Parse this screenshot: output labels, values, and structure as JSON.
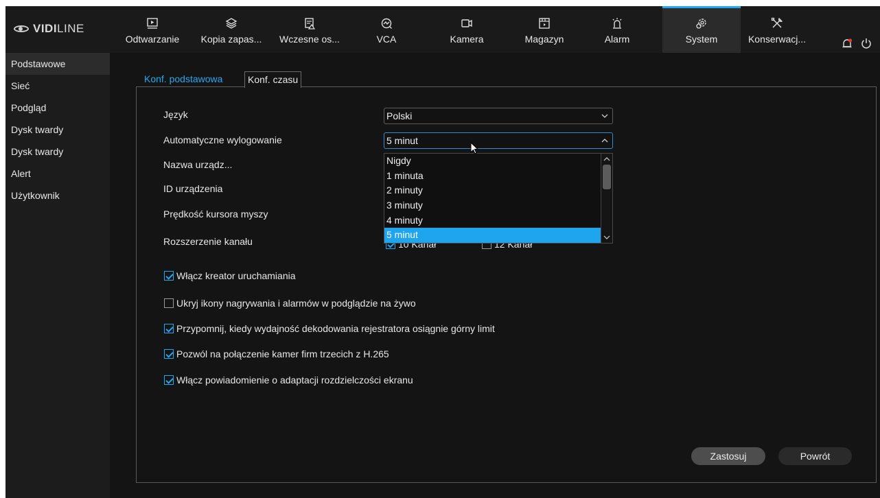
{
  "brand": {
    "name_bold": "VIDI",
    "name_thin": "LINE"
  },
  "nav": [
    {
      "label": "Odtwarzanie",
      "icon": "playback-icon"
    },
    {
      "label": "Kopia zapas...",
      "icon": "backup-layers-icon"
    },
    {
      "label": "Wczesne os...",
      "icon": "warning-document-icon"
    },
    {
      "label": "VCA",
      "icon": "vca-analytics-icon"
    },
    {
      "label": "Kamera",
      "icon": "camera-icon"
    },
    {
      "label": "Magazyn",
      "icon": "storage-icon"
    },
    {
      "label": "Alarm",
      "icon": "alarm-siren-icon"
    },
    {
      "label": "System",
      "icon": "system-gear-icon",
      "active": true
    },
    {
      "label": "Konserwacj...",
      "icon": "maintenance-tools-icon"
    }
  ],
  "sidebar": {
    "items": [
      {
        "label": "Podstawowe",
        "active": true
      },
      {
        "label": "Sieć"
      },
      {
        "label": "Podgląd"
      },
      {
        "label": "Dysk twardy"
      },
      {
        "label": "Dysk twardy"
      },
      {
        "label": "Alert"
      },
      {
        "label": "Użytkownik"
      }
    ]
  },
  "tabs": {
    "basic": "Konf. podstawowa",
    "time": "Konf. czasu"
  },
  "form": {
    "language_label": "Język",
    "language_value": "Polski",
    "autologout_label": "Automatyczne wylogowanie",
    "autologout_value": "5 minut",
    "device_name_label": "Nazwa urządz...",
    "device_id_label": "ID urządzenia",
    "mouse_speed_label": "Prędkość kursora myszy",
    "channel_ext_label": "Rozszerzenie kanału",
    "channel_opt1": "10 Kanał",
    "channel_opt2": "12 Kanał"
  },
  "dropdown": {
    "options": [
      "Nigdy",
      "1 minuta",
      "2 minuty",
      "3 minuty",
      "4 minuty",
      "5 minut"
    ],
    "selected_index": 5
  },
  "checkboxes": [
    {
      "label": "Włącz kreator uruchamiania",
      "checked": true
    },
    {
      "label": "Ukryj ikony nagrywania  i alarmów w podglądzie na żywo",
      "checked": false
    },
    {
      "label": "Przypomnij, kiedy wydajność dekodowania rejestratora osiągnie górny limit",
      "checked": true
    },
    {
      "label": "Pozwól na połączenie kamer firm trzecich z H.265",
      "checked": true
    },
    {
      "label": "Włącz powiadomienie o adaptacji rozdzielczości ekranu",
      "checked": true
    }
  ],
  "buttons": {
    "apply": "Zastosuj",
    "back": "Powrót"
  },
  "colors": {
    "accent": "#1ea7f2",
    "background": "#121212",
    "alert_dot": "#e53935"
  }
}
